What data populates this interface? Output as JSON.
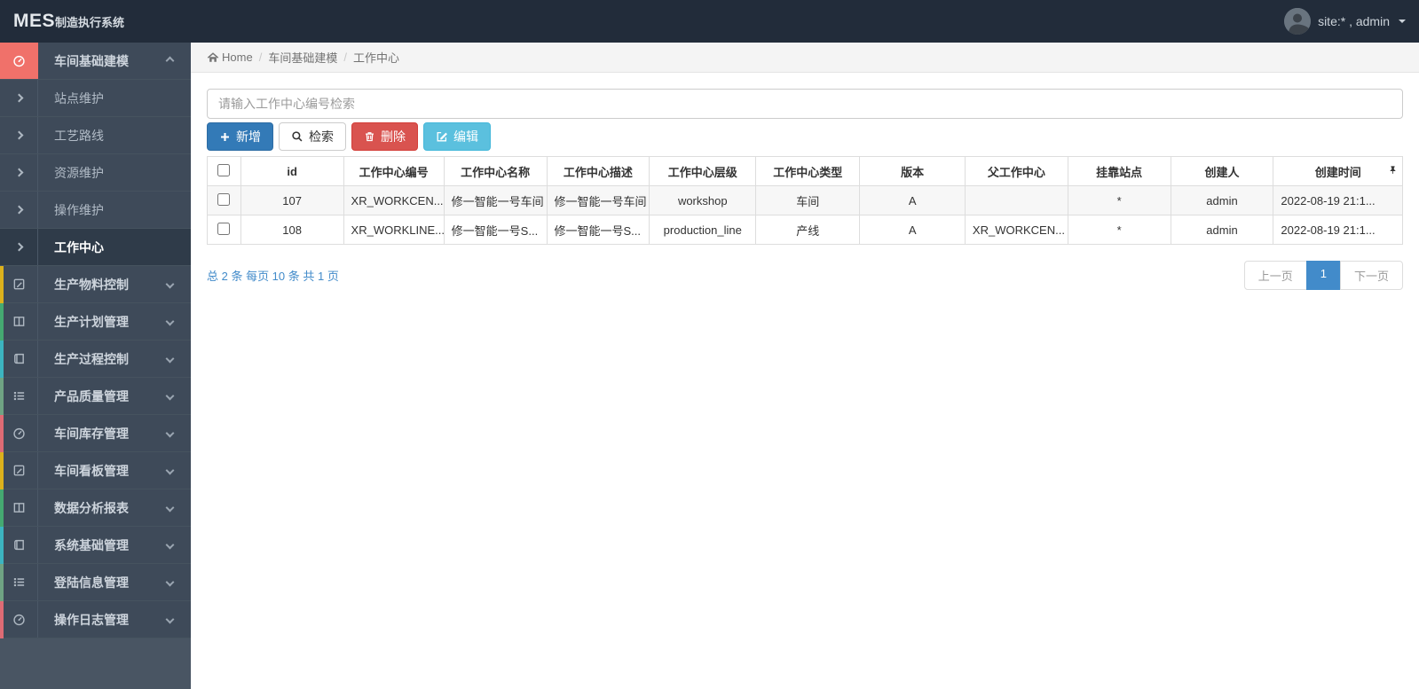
{
  "navbar": {
    "brand_bold": "MES",
    "brand_small": "制造执行系统",
    "user": "site:* , admin"
  },
  "breadcrumb": {
    "home": "Home",
    "parent": "车间基础建模",
    "current": "工作中心"
  },
  "sidebar": {
    "group": {
      "key": "workshop-modeling",
      "label": "车间基础建模",
      "icon": "gauge-icon",
      "children": [
        {
          "key": "station-maintenance",
          "label": "站点维护",
          "active": false
        },
        {
          "key": "process-route",
          "label": "工艺路线",
          "active": false
        },
        {
          "key": "resource-maintenance",
          "label": "资源维护",
          "active": false
        },
        {
          "key": "operation-maintenance",
          "label": "操作维护",
          "active": false
        },
        {
          "key": "work-center",
          "label": "工作中心",
          "active": true
        }
      ]
    },
    "items": [
      {
        "key": "material-control",
        "label": "生产物料控制",
        "icon": "pencil-square-icon",
        "strip": "#dcb11c"
      },
      {
        "key": "plan-management",
        "label": "生产计划管理",
        "icon": "columns-icon",
        "strip": "#45a971"
      },
      {
        "key": "process-control",
        "label": "生产过程控制",
        "icon": "book-icon",
        "strip": "#3cb4c0"
      },
      {
        "key": "quality-management",
        "label": "产品质量管理",
        "icon": "list-icon",
        "strip": "#6fa383"
      },
      {
        "key": "inventory-management",
        "label": "车间库存管理",
        "icon": "gauge-icon",
        "strip": "#de6b74"
      },
      {
        "key": "kanban-management",
        "label": "车间看板管理",
        "icon": "pencil-square-icon",
        "strip": "#dcb11c"
      },
      {
        "key": "data-analysis-report",
        "label": "数据分析报表",
        "icon": "columns-icon",
        "strip": "#45a971"
      },
      {
        "key": "system-management",
        "label": "系统基础管理",
        "icon": "book-icon",
        "strip": "#3cb4c0"
      },
      {
        "key": "login-info-management",
        "label": "登陆信息管理",
        "icon": "list-icon",
        "strip": "#6fa383"
      },
      {
        "key": "operation-log",
        "label": "操作日志管理",
        "icon": "gauge-icon",
        "strip": "#de6b74"
      }
    ]
  },
  "search": {
    "placeholder": "请输入工作中心编号检索"
  },
  "toolbar": {
    "add": "新增",
    "search": "检索",
    "delete": "删除",
    "edit": "编辑"
  },
  "table": {
    "columns": [
      "id",
      "工作中心编号",
      "工作中心名称",
      "工作中心描述",
      "工作中心层级",
      "工作中心类型",
      "版本",
      "父工作中心",
      "挂靠站点",
      "创建人",
      "创建时间"
    ],
    "rows": [
      [
        "107",
        "XR_WORKCEN...",
        "修一智能一号车间",
        "修一智能一号车间",
        "workshop",
        "车间",
        "A",
        "",
        "*",
        "admin",
        "2022-08-19 21:1..."
      ],
      [
        "108",
        "XR_WORKLINE...",
        "修一智能一号S...",
        "修一智能一号S...",
        "production_line",
        "产线",
        "A",
        "XR_WORKCEN...",
        "*",
        "admin",
        "2022-08-19 21:1..."
      ]
    ]
  },
  "pagination": {
    "summary": "总 2 条  每页 10 条  共 1 页",
    "prev": "上一页",
    "page": "1",
    "next": "下一页"
  },
  "colors": {
    "navbar_bg": "#222c3a",
    "sidebar_item_bg": "#3e4a59",
    "sidebar_active_bg": "#2f3b49",
    "accent_red": "#f0716a",
    "primary": "#337ab7",
    "danger": "#d9534f",
    "info": "#5bc0de",
    "link_blue": "#428bca"
  }
}
